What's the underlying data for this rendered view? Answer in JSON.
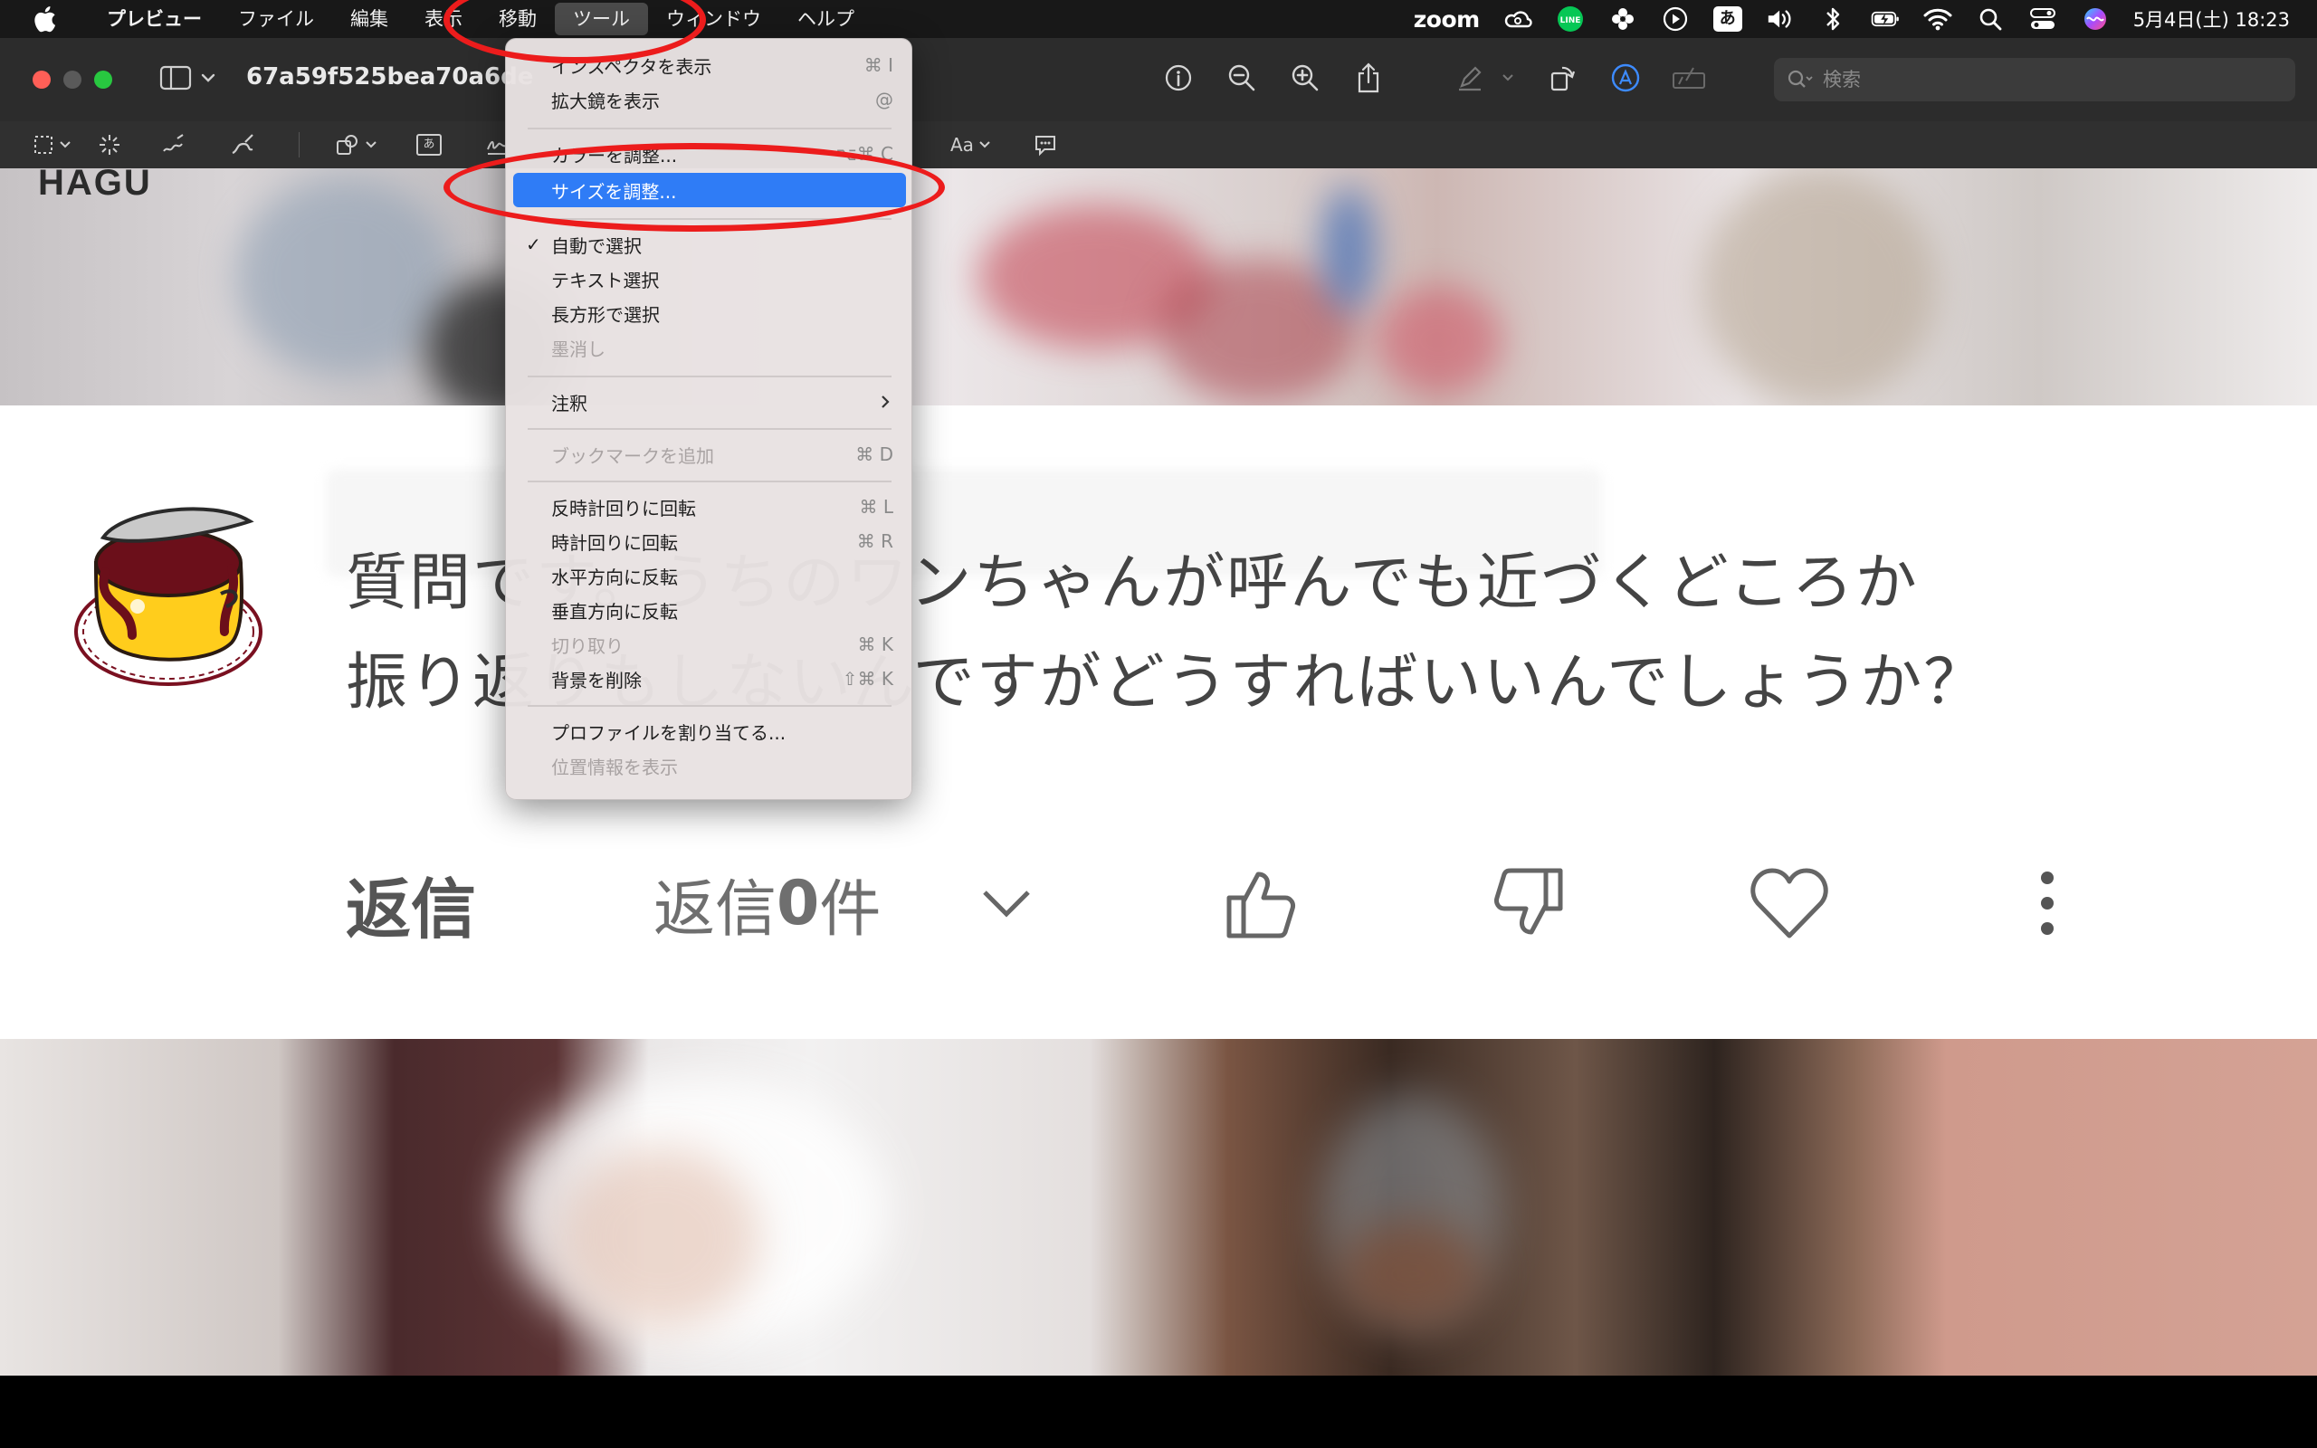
{
  "menubar": {
    "app_name": "プレビュー",
    "menus": [
      "ファイル",
      "編集",
      "表示",
      "移動",
      "ツール",
      "ウィンドウ",
      "ヘルプ"
    ],
    "open_menu_index": 4,
    "status": {
      "zoom_label": "zoom",
      "ime_label": "あ",
      "line_label": "LINE",
      "clock": "5月4日(土) 18:23"
    }
  },
  "window": {
    "doc_title": "67a59f525bea70a6de",
    "search_placeholder": "検索"
  },
  "markup": {
    "text_style_label": "Aa",
    "text_box_label": "あ"
  },
  "tools_menu": {
    "items": [
      {
        "label": "インスペクタを表示",
        "shortcut": "⌘ I",
        "disabled": false,
        "checked": false,
        "submenu": false,
        "highlighted": false
      },
      {
        "label": "拡大鏡を表示",
        "shortcut": "@",
        "disabled": false,
        "checked": false,
        "submenu": false,
        "highlighted": false
      },
      {
        "label": "カラーを調整...",
        "shortcut": "⌥⌘ C",
        "disabled": false,
        "checked": false,
        "submenu": false,
        "highlighted": false
      },
      {
        "label": "サイズを調整...",
        "shortcut": "",
        "disabled": false,
        "checked": false,
        "submenu": false,
        "highlighted": true
      },
      {
        "label": "自動で選択",
        "shortcut": "",
        "disabled": false,
        "checked": true,
        "submenu": false,
        "highlighted": false
      },
      {
        "label": "テキスト選択",
        "shortcut": "",
        "disabled": false,
        "checked": false,
        "submenu": false,
        "highlighted": false
      },
      {
        "label": "長方形で選択",
        "shortcut": "",
        "disabled": false,
        "checked": false,
        "submenu": false,
        "highlighted": false
      },
      {
        "label": "墨消し",
        "shortcut": "",
        "disabled": true,
        "checked": false,
        "submenu": false,
        "highlighted": false
      },
      {
        "label": "注釈",
        "shortcut": "",
        "disabled": false,
        "checked": false,
        "submenu": true,
        "highlighted": false
      },
      {
        "label": "ブックマークを追加",
        "shortcut": "⌘ D",
        "disabled": true,
        "checked": false,
        "submenu": false,
        "highlighted": false
      },
      {
        "label": "反時計回りに回転",
        "shortcut": "⌘ L",
        "disabled": false,
        "checked": false,
        "submenu": false,
        "highlighted": false
      },
      {
        "label": "時計回りに回転",
        "shortcut": "⌘ R",
        "disabled": false,
        "checked": false,
        "submenu": false,
        "highlighted": false
      },
      {
        "label": "水平方向に反転",
        "shortcut": "",
        "disabled": false,
        "checked": false,
        "submenu": false,
        "highlighted": false
      },
      {
        "label": "垂直方向に反転",
        "shortcut": "",
        "disabled": false,
        "checked": false,
        "submenu": false,
        "highlighted": false
      },
      {
        "label": "切り取り",
        "shortcut": "⌘ K",
        "disabled": true,
        "checked": false,
        "submenu": false,
        "highlighted": false
      },
      {
        "label": "背景を削除",
        "shortcut": "⇧⌘ K",
        "disabled": false,
        "checked": false,
        "submenu": false,
        "highlighted": false
      },
      {
        "label": "プロファイルを割り当てる...",
        "shortcut": "",
        "disabled": false,
        "checked": false,
        "submenu": false,
        "highlighted": false
      },
      {
        "label": "位置情報を表示",
        "shortcut": "",
        "disabled": true,
        "checked": false,
        "submenu": false,
        "highlighted": false
      }
    ],
    "checkmark": "✓"
  },
  "image_content": {
    "logo": "HAGU",
    "question_line1": "質問です。うちのワンちゃんが呼んでも近づくどころか",
    "question_line2": "振り返りもしないんですがどうすればいいんでしょうか？",
    "reply_label": "返信",
    "reply_count_prefix": "返信 ",
    "reply_count": "0",
    "reply_count_suffix": " 件"
  },
  "colors": {
    "menu_highlight": "#2f7cf6",
    "annotation_ring": "#ec1c1c",
    "traffic_close": "#ff5f57",
    "traffic_min": "#5a5a5a",
    "traffic_max": "#28c840"
  }
}
